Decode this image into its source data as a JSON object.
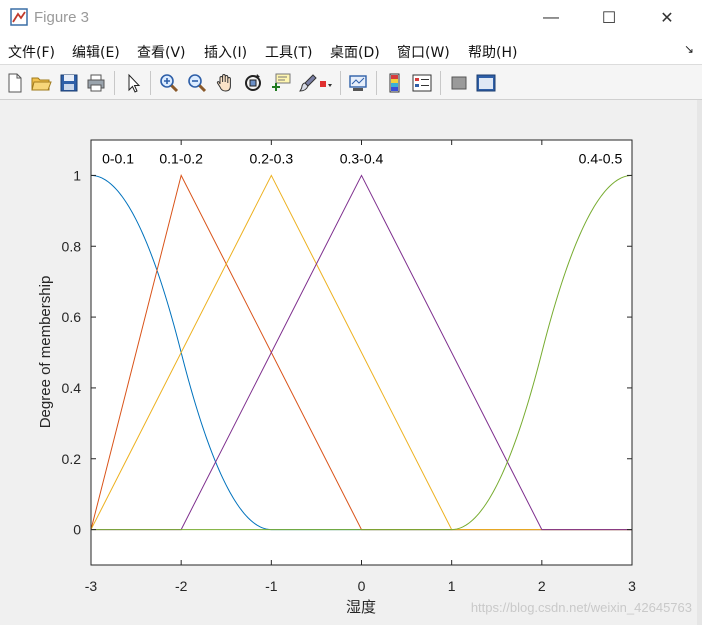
{
  "window": {
    "title": "Figure 3",
    "min_glyph": "—",
    "max_glyph": "☐",
    "close_glyph": "✕",
    "icon": "matlab-figure-icon"
  },
  "menu": {
    "items": [
      "文件(F)",
      "编辑(E)",
      "查看(V)",
      "插入(I)",
      "工具(T)",
      "桌面(D)",
      "窗口(W)",
      "帮助(H)"
    ],
    "dock_glyph": "↘"
  },
  "toolbar": {
    "icons": [
      "new-figure-icon",
      "open-file-icon",
      "save-icon",
      "print-icon",
      "select-arrow-icon",
      "zoom-in-icon",
      "zoom-out-icon",
      "pan-hand-icon",
      "rotate-3d-icon",
      "data-cursor-icon",
      "brush-icon",
      "brush-dropdown-icon",
      "link-plot-icon",
      "insert-colorbar-icon",
      "insert-legend-icon",
      "hide-plot-tools-icon",
      "show-plot-tools-icon"
    ]
  },
  "chart_data": {
    "type": "line",
    "title": "",
    "xlabel": "湿度",
    "ylabel": "Degree of membership",
    "xlim": [
      -3,
      3
    ],
    "ylim": [
      -0.1,
      1.1
    ],
    "xticks": [
      -3,
      -2,
      -1,
      0,
      1,
      2,
      3
    ],
    "yticks": [
      0,
      0.2,
      0.4,
      0.6,
      0.8,
      1
    ],
    "grid": false,
    "series": [
      {
        "name": "0-0.1",
        "shape": "z-shaped",
        "params": [
          -3,
          -1
        ],
        "color": "#0072BD",
        "label_x": -2.7
      },
      {
        "name": "0.1-0.2",
        "shape": "triangle",
        "params": [
          -3,
          -2,
          0
        ],
        "color": "#D95319",
        "label_x": -2
      },
      {
        "name": "0.2-0.3",
        "shape": "triangle",
        "params": [
          -3,
          -1,
          1
        ],
        "color": "#EDB120",
        "label_x": -1
      },
      {
        "name": "0.3-0.4",
        "shape": "triangle",
        "params": [
          -2,
          0,
          2
        ],
        "color": "#7E2F8E",
        "label_x": 0
      },
      {
        "name": "0.4-0.5",
        "shape": "s-shaped",
        "params": [
          1,
          3
        ],
        "color": "#77AC30",
        "label_x": 2.65
      }
    ]
  },
  "watermark": "https://blog.csdn.net/weixin_42645763"
}
